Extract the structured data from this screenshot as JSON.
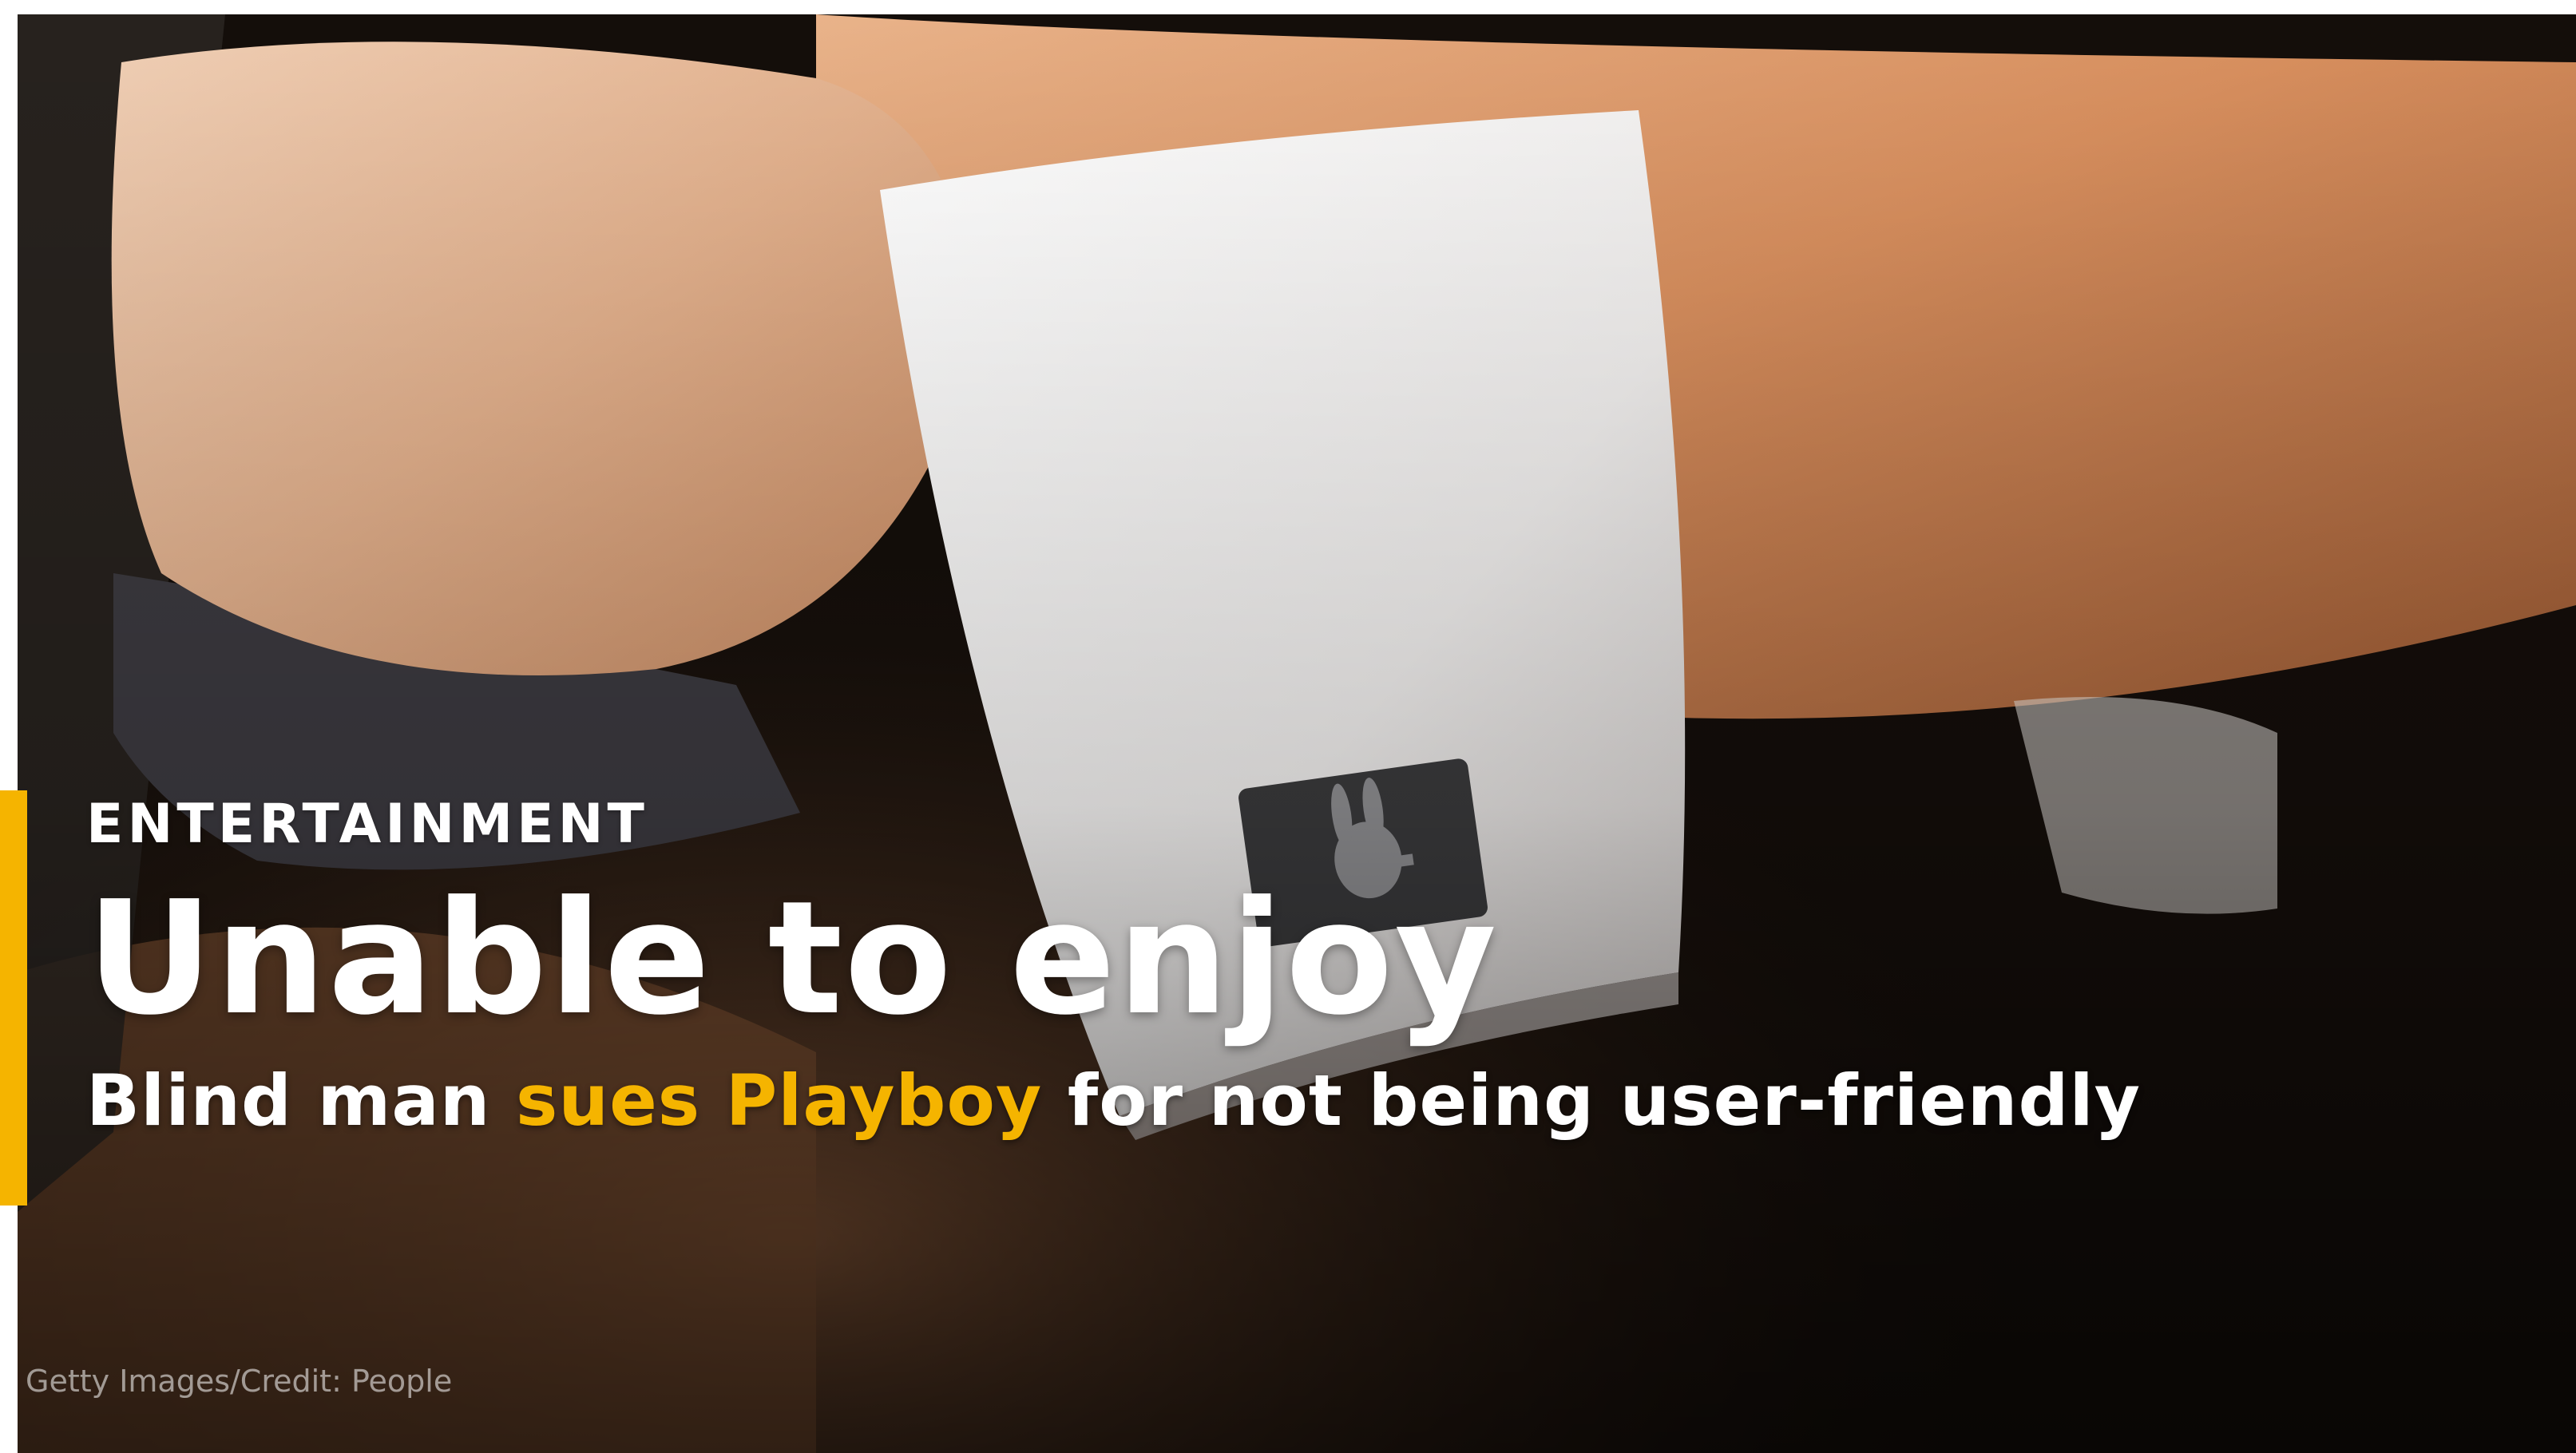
{
  "photo": {
    "credit": "Getty Images/Credit: People",
    "logo_icon": "playboy-bunny-icon"
  },
  "overlay": {
    "category": "ENTERTAINMENT",
    "headline": "Unable to enjoy",
    "subhead": {
      "part1": "Blind man ",
      "highlight": "sues Playboy",
      "part2": " for not being user-friendly"
    }
  },
  "colors": {
    "accent": "#f5b400",
    "text": "#ffffff"
  }
}
